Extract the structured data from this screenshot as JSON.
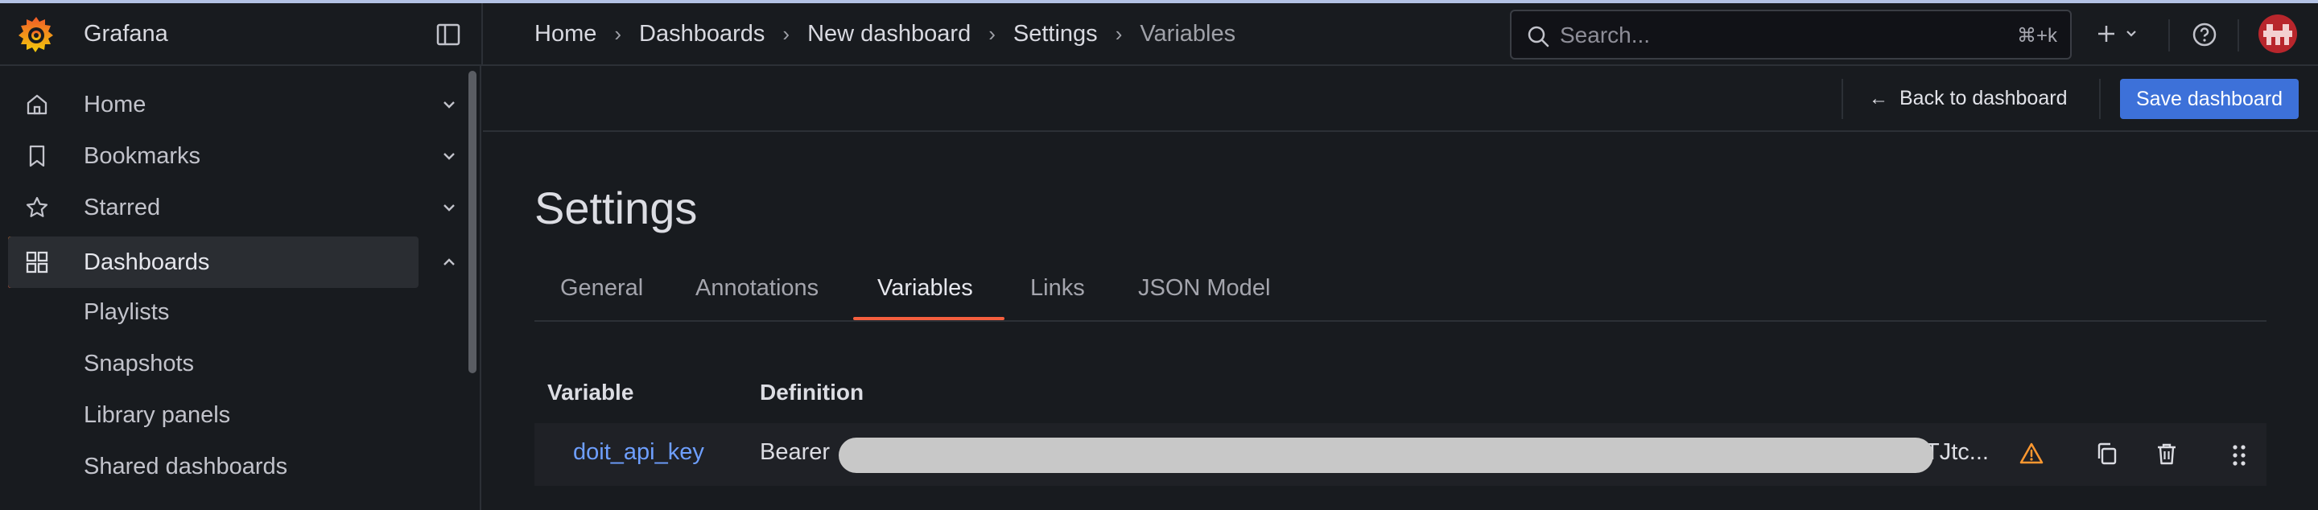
{
  "app": {
    "name": "Grafana"
  },
  "colors": {
    "accent": "#f55f3e",
    "primary": "#3d71d9",
    "link": "#6e9fff",
    "warning": "#ff9830"
  },
  "breadcrumb": [
    "Home",
    "Dashboards",
    "New dashboard",
    "Settings",
    "Variables"
  ],
  "search": {
    "placeholder": "Search...",
    "shortcut": "⌘+k"
  },
  "sidebar": {
    "items": [
      {
        "label": "Home",
        "icon": "home-icon",
        "expanded": false
      },
      {
        "label": "Bookmarks",
        "icon": "bookmark-icon",
        "expanded": false
      },
      {
        "label": "Starred",
        "icon": "star-icon",
        "expanded": false
      },
      {
        "label": "Dashboards",
        "icon": "apps-icon",
        "expanded": true,
        "active": true
      }
    ],
    "sub_items": [
      "Playlists",
      "Snapshots",
      "Library panels",
      "Shared dashboards"
    ]
  },
  "actions": {
    "back_label": "Back to dashboard",
    "save_label": "Save dashboard"
  },
  "page": {
    "title": "Settings"
  },
  "tabs": [
    {
      "label": "General"
    },
    {
      "label": "Annotations"
    },
    {
      "label": "Variables",
      "active": true
    },
    {
      "label": "Links"
    },
    {
      "label": "JSON Model"
    }
  ],
  "table": {
    "headers": [
      "Variable",
      "Definition"
    ],
    "rows": [
      {
        "name": "doit_api_key",
        "definition_prefix": "Bearer",
        "definition_suffix": "TJtc...",
        "warning": true
      }
    ]
  }
}
